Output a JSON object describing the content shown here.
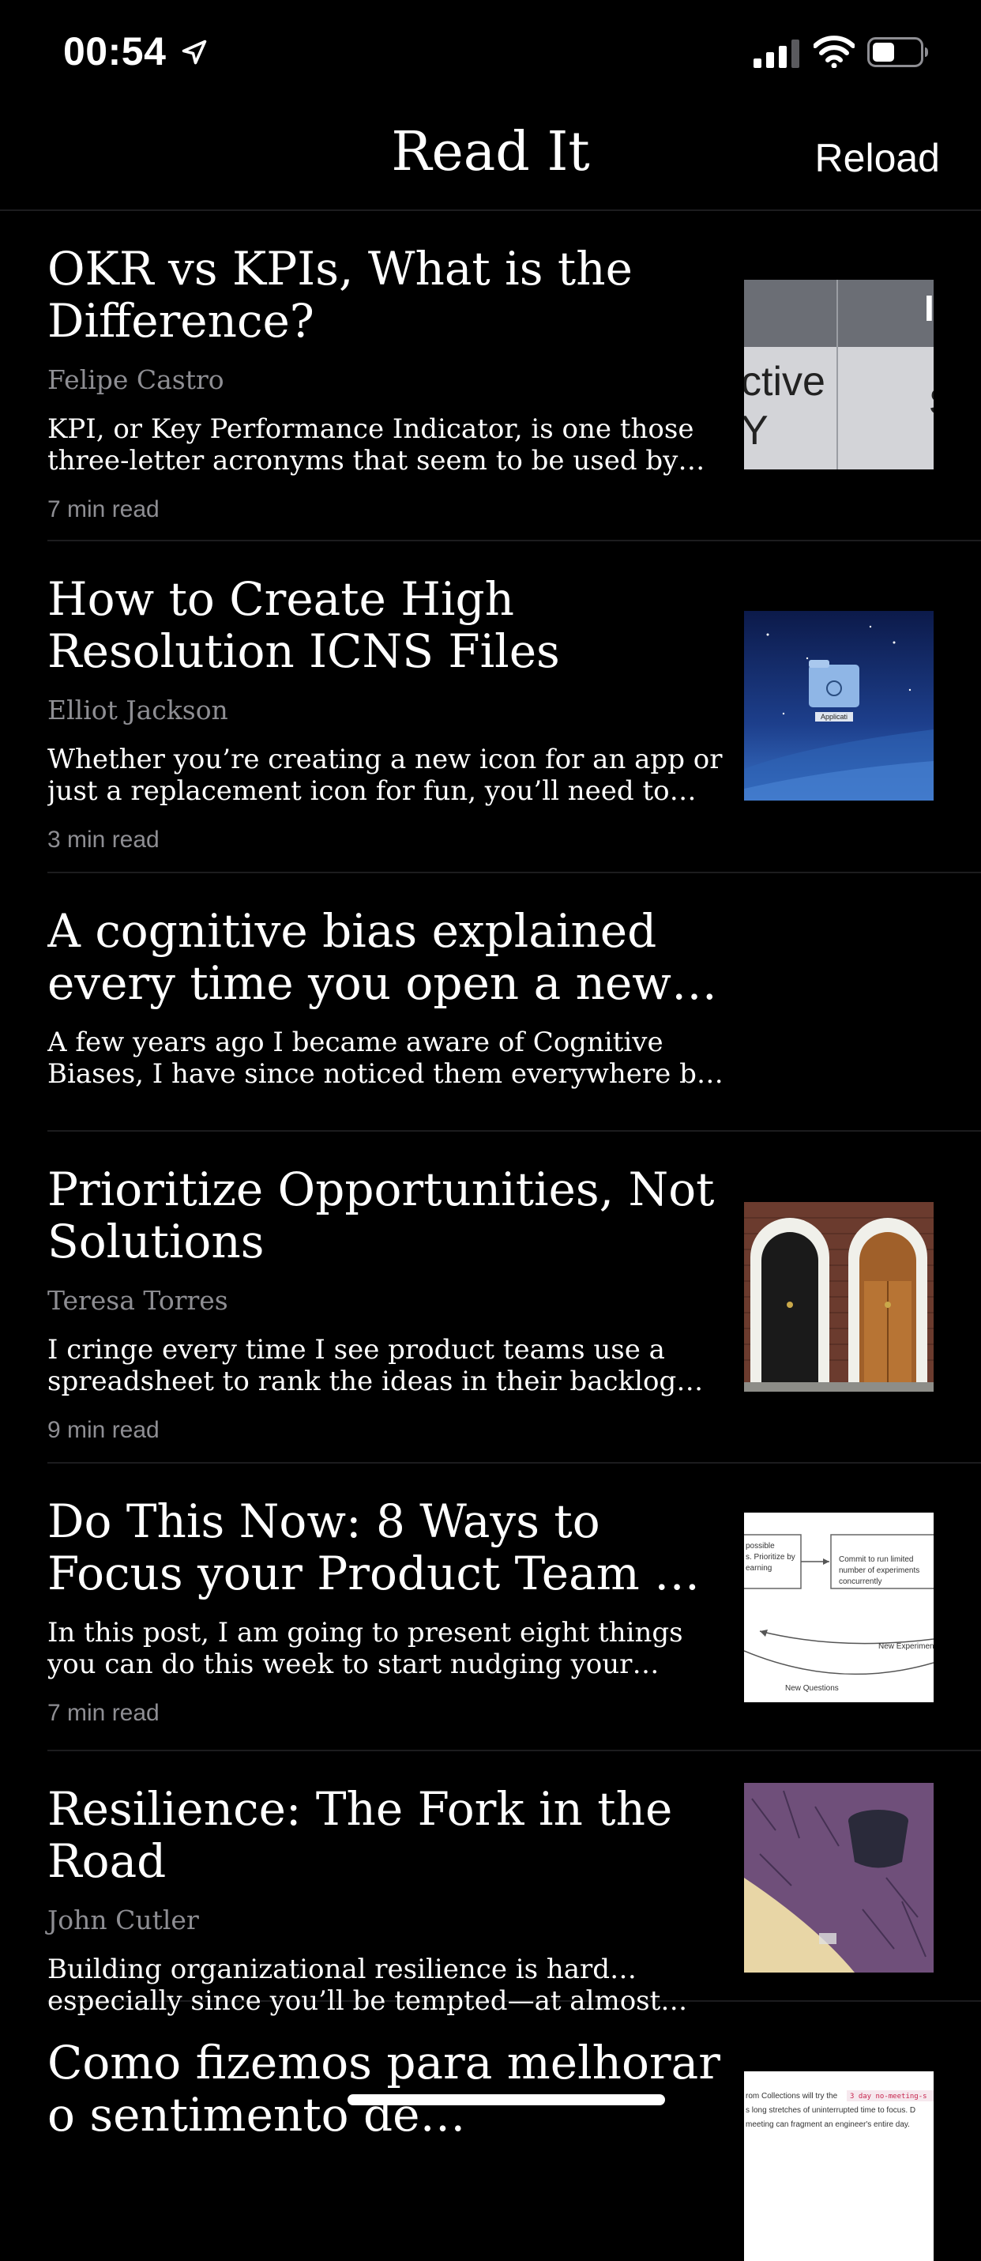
{
  "status": {
    "time": "00:54"
  },
  "nav": {
    "title": "Read It",
    "reload_label": "Reload"
  },
  "articles": [
    {
      "title": "OKR vs KPIs, What is the Difference?",
      "author": "Felipe Castro",
      "excerpt": "KPI, or Key Performance Indicator, is one those three-letter acronyms that seem to be used by every orga…",
      "read_time": "7 min read",
      "thumb_text": [
        "ctive",
        "Y",
        "I",
        "S"
      ]
    },
    {
      "title": "How to Create High Resolution ICNS Files",
      "author": "Elliot Jackson",
      "excerpt": "Whether you’re creating a new icon for an app or just a replacement icon for fun, you’ll need to convert it…",
      "read_time": "3 min read",
      "thumb_text": [
        "Applicati"
      ]
    },
    {
      "title": "A cognitive bias explained every time you open a new tab",
      "author": "",
      "excerpt": "A few years ago I became aware of Cognitive Biases, I have since noticed them everywhere but most imp…",
      "read_time": ""
    },
    {
      "title": "Prioritize Opportunities, Not Solutions",
      "author": "Teresa Torres",
      "excerpt": "I cringe every time I see product teams use a spreadsheet to rank the ideas in their backlog base…",
      "read_time": "9 min read"
    },
    {
      "title": "Do This Now: 8 Ways to Focus your Product Team on Impact…",
      "author": "",
      "excerpt": "In this post, I am going to present eight things you can do this week to start nudging your organizatio…",
      "read_time": "7 min read",
      "thumb_text": [
        "possible",
        "s. Prioritize by",
        "earning",
        "Commit to run limited",
        "number of experiments",
        "concurrently",
        "New Experiments",
        "New Questions"
      ]
    },
    {
      "title": "Resilience: The Fork in the Road",
      "author": "John Cutler",
      "excerpt": "Building organizational resilience is hard…especially since you’ll be tempted—at almost every turn—to…",
      "read_time": ""
    },
    {
      "title": "Como fizemos para melhorar o sentimento de produtividade…",
      "author": "",
      "excerpt": "",
      "read_time": "",
      "thumb_text": [
        "rom Collections will try the",
        "3 day no-meeting-s",
        "s long stretches of uninterrupted time to focus. D",
        "meeting can fragment an engineer's entire day."
      ]
    }
  ]
}
